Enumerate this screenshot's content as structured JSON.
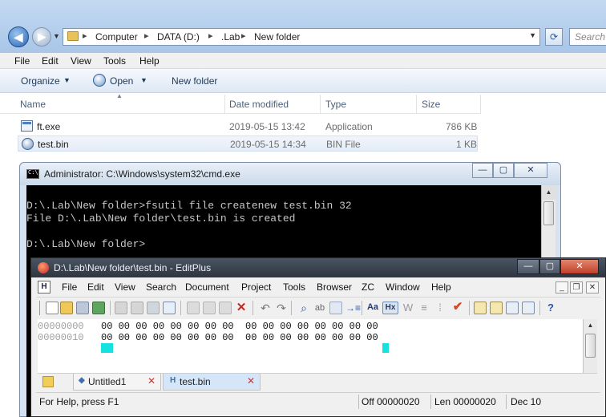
{
  "explorer": {
    "address": {
      "crumbs": [
        "Computer",
        "DATA (D:)",
        ".Lab",
        "New folder"
      ]
    },
    "search_placeholder": "Search",
    "menubar": [
      "File",
      "Edit",
      "View",
      "Tools",
      "Help"
    ],
    "commands": {
      "organize": "Organize",
      "open": "Open",
      "new_folder": "New folder"
    },
    "columns": {
      "name": "Name",
      "date": "Date modified",
      "type": "Type",
      "size": "Size"
    },
    "files": [
      {
        "name": "ft.exe",
        "date": "2019-05-15 13:42",
        "type": "Application",
        "size": "786 KB",
        "icon": "application-icon"
      },
      {
        "name": "test.bin",
        "date": "2019-05-15 14:34",
        "type": "BIN File",
        "size": "1 KB",
        "icon": "bin-file-icon"
      }
    ]
  },
  "cmd": {
    "title": "Administrator: C:\\Windows\\system32\\cmd.exe",
    "lines": [
      "D:\\.Lab\\New folder>fsutil file createnew test.bin 32",
      "File D:\\.Lab\\New folder\\test.bin is created",
      "",
      "D:\\.Lab\\New folder>"
    ]
  },
  "editplus": {
    "title": "D:\\.Lab\\New folder\\test.bin - EditPlus",
    "menubar": [
      "File",
      "Edit",
      "View",
      "Search",
      "Document",
      "Project",
      "Tools",
      "Browser",
      "ZC",
      "Window",
      "Help"
    ],
    "hex_rows": [
      {
        "addr": "00000000",
        "bytes": "00 00 00 00 00 00 00 00  00 00 00 00 00 00 00 00"
      },
      {
        "addr": "00000010",
        "bytes": "00 00 00 00 00 00 00 00  00 00 00 00 00 00 00 00"
      }
    ],
    "tabs": [
      {
        "label": "Untitled1"
      },
      {
        "label": "test.bin"
      }
    ],
    "status": {
      "help": "For Help, press F1",
      "offset": "Off 00000020",
      "length": "Len 00000020",
      "dec": "Dec 10"
    }
  }
}
